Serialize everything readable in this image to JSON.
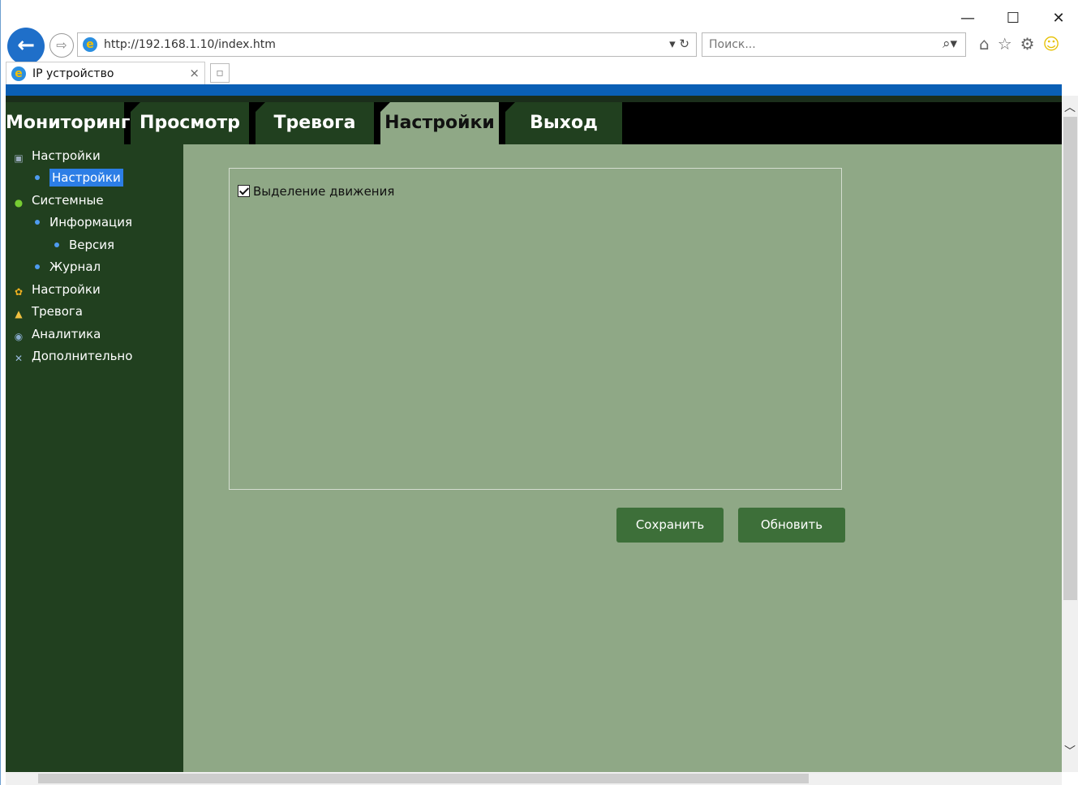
{
  "browser": {
    "url": "http://192.168.1.10/index.htm",
    "search_placeholder": "Поиск...",
    "tab_title": "IP устройство",
    "minimize": "—",
    "maximize": "☐",
    "close": "✕"
  },
  "nav": {
    "tabs": [
      {
        "label": "Мониторинг"
      },
      {
        "label": "Просмотр"
      },
      {
        "label": "Тревога"
      },
      {
        "label": "Настройки"
      },
      {
        "label": "Выход"
      }
    ],
    "active_index": 3
  },
  "sidebar": {
    "items": [
      {
        "label": "Настройки",
        "icon": "camera-icon"
      },
      {
        "label": "Настройки",
        "selected": true
      },
      {
        "label": "Системные",
        "icon": "info-icon"
      },
      {
        "label": "Информация"
      },
      {
        "label": "Версия"
      },
      {
        "label": "Журнал"
      },
      {
        "label": "Настройки",
        "icon": "gear-icon"
      },
      {
        "label": "Тревога",
        "icon": "bell-icon"
      },
      {
        "label": "Аналитика",
        "icon": "analytics-icon"
      },
      {
        "label": "Дополнительно",
        "icon": "tools-icon"
      }
    ]
  },
  "main": {
    "motion_checkbox_label": "Выделение движения",
    "motion_checked": true,
    "save_label": "Сохранить",
    "refresh_label": "Обновить"
  },
  "colors": {
    "sidebar_bg": "#21401f",
    "content_bg": "#8fa886",
    "button_bg": "#3d6f39",
    "selected_bg": "#2c7ee6",
    "browser_accent": "#0a5fb5"
  }
}
